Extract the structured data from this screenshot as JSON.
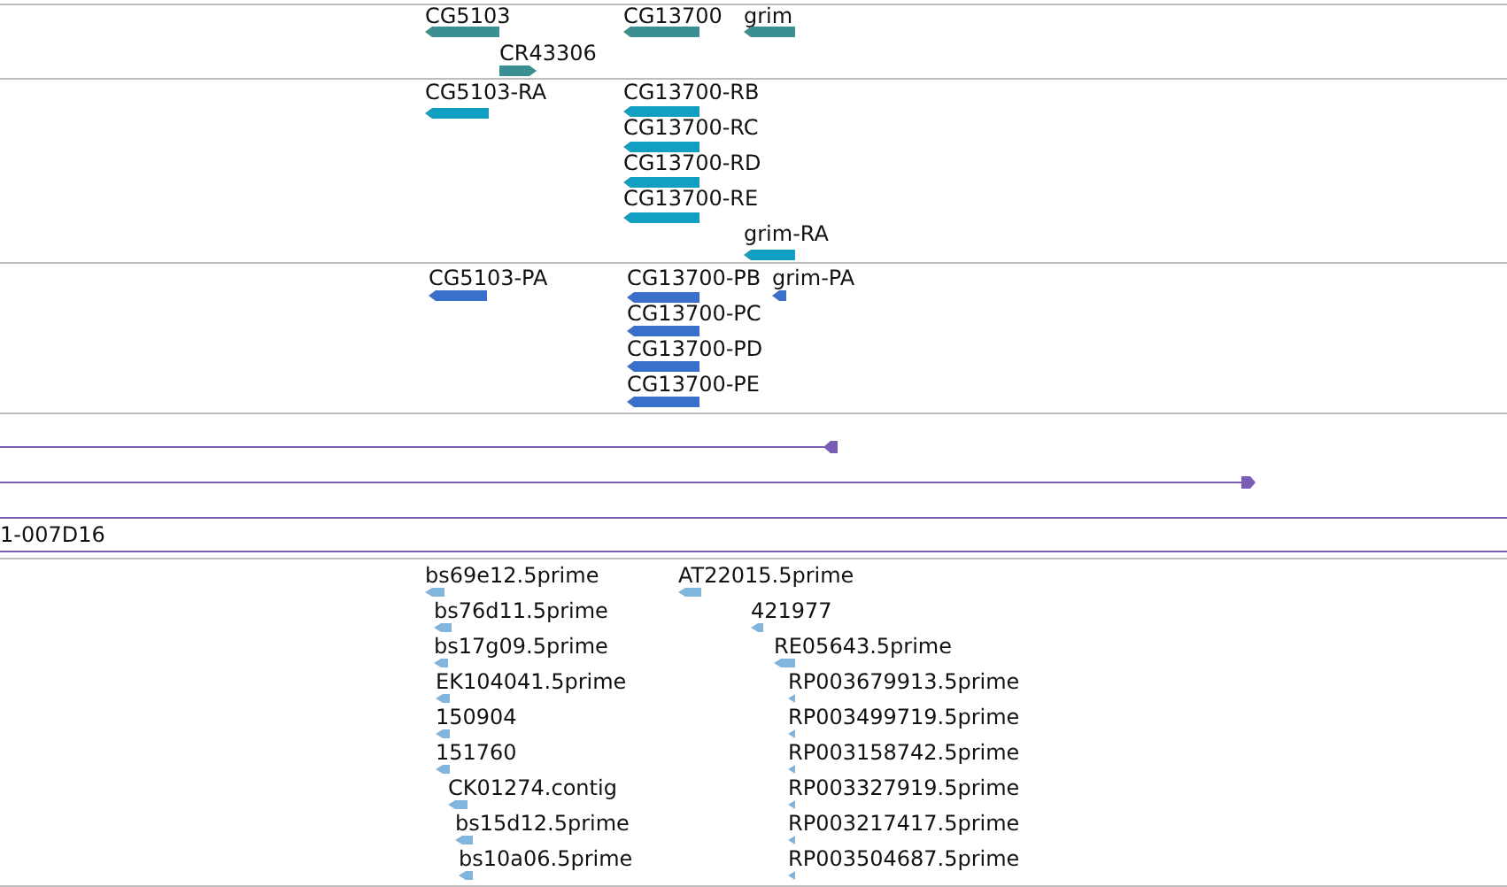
{
  "tracks": [
    {
      "kind": "genes",
      "features": [
        {
          "label": "CG5103",
          "reverse": true
        },
        {
          "label": "CR43306",
          "reverse": false
        },
        {
          "label": "CG13700",
          "reverse": true
        },
        {
          "label": "grim",
          "reverse": true
        }
      ]
    },
    {
      "kind": "transcripts",
      "features": [
        {
          "label": "CG5103-RA",
          "reverse": true
        },
        {
          "label": "CG13700-RB",
          "reverse": true
        },
        {
          "label": "CG13700-RC",
          "reverse": true
        },
        {
          "label": "CG13700-RD",
          "reverse": true
        },
        {
          "label": "CG13700-RE",
          "reverse": true
        },
        {
          "label": "grim-RA",
          "reverse": true
        }
      ]
    },
    {
      "kind": "proteins",
      "features": [
        {
          "label": "CG5103-PA",
          "reverse": true
        },
        {
          "label": "CG13700-PB",
          "reverse": true
        },
        {
          "label": "grim-PA",
          "reverse": true
        },
        {
          "label": "CG13700-PC",
          "reverse": true
        },
        {
          "label": "CG13700-PD",
          "reverse": true
        },
        {
          "label": "CG13700-PE",
          "reverse": true
        }
      ]
    },
    {
      "kind": "clones",
      "features": [
        {
          "kind": "line",
          "reverse": true
        },
        {
          "kind": "line",
          "reverse": false
        },
        {
          "kind": "bar",
          "label": "1-007D16"
        }
      ]
    },
    {
      "kind": "ests",
      "features": [
        {
          "label": "bs69e12.5prime",
          "reverse": true
        },
        {
          "label": "AT22015.5prime",
          "reverse": true
        },
        {
          "label": "bs76d11.5prime",
          "reverse": true
        },
        {
          "label": "421977",
          "reverse": true
        },
        {
          "label": "bs17g09.5prime",
          "reverse": true
        },
        {
          "label": "RE05643.5prime",
          "reverse": true
        },
        {
          "label": "EK104041.5prime",
          "reverse": true
        },
        {
          "label": "RP003679913.5prime",
          "reverse": true
        },
        {
          "label": "150904",
          "reverse": true
        },
        {
          "label": "RP003499719.5prime",
          "reverse": true
        },
        {
          "label": "151760",
          "reverse": true
        },
        {
          "label": "RP003158742.5prime",
          "reverse": true
        },
        {
          "label": "CK01274.contig",
          "reverse": true
        },
        {
          "label": "RP003327919.5prime",
          "reverse": true
        },
        {
          "label": "bs15d12.5prime",
          "reverse": true
        },
        {
          "label": "RP003217417.5prime",
          "reverse": true
        },
        {
          "label": "bs10a06.5prime",
          "reverse": true
        },
        {
          "label": "RP003504687.5prime",
          "reverse": true
        }
      ]
    }
  ]
}
